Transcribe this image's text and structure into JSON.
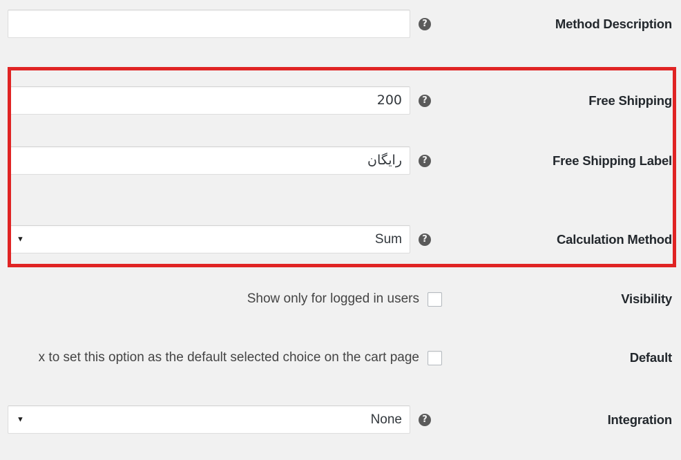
{
  "page": {
    "background_color": "#f1f1f1",
    "text_color": "#23282d",
    "direction": "rtl"
  },
  "highlight": {
    "name": "red-highlight-box",
    "color": "#e02424",
    "border_width_px": 5,
    "encloses": [
      "Free Shipping",
      "Free Shipping Label",
      "Calculation Method"
    ]
  },
  "icons": {
    "help": "?",
    "dropdown_arrow": "▼"
  },
  "rows": [
    {
      "id": "method-description",
      "label": "Method Description",
      "control": "text",
      "value": "",
      "placeholder": "",
      "help_icon": "help-icon"
    },
    {
      "id": "free-shipping",
      "label": "Free Shipping",
      "control": "text",
      "value": "200",
      "placeholder": "",
      "help_icon": "help-icon"
    },
    {
      "id": "free-shipping-label",
      "label": "Free Shipping Label",
      "control": "text",
      "value": "رایگان",
      "placeholder": "",
      "help_icon": "help-icon"
    },
    {
      "id": "calculation-method",
      "label": "Calculation Method",
      "control": "select",
      "value": "Sum",
      "help_icon": "help-icon"
    },
    {
      "id": "visibility",
      "label": "Visibility",
      "control": "checkbox",
      "checkbox_label": "Show only for logged in users",
      "checked": false
    },
    {
      "id": "default",
      "label": "Default",
      "control": "checkbox",
      "checkbox_label": "x to set this option as the default selected choice on the cart page",
      "checked": false
    },
    {
      "id": "integration",
      "label": "Integration",
      "control": "select",
      "value": "None",
      "help_icon": "help-icon"
    }
  ]
}
